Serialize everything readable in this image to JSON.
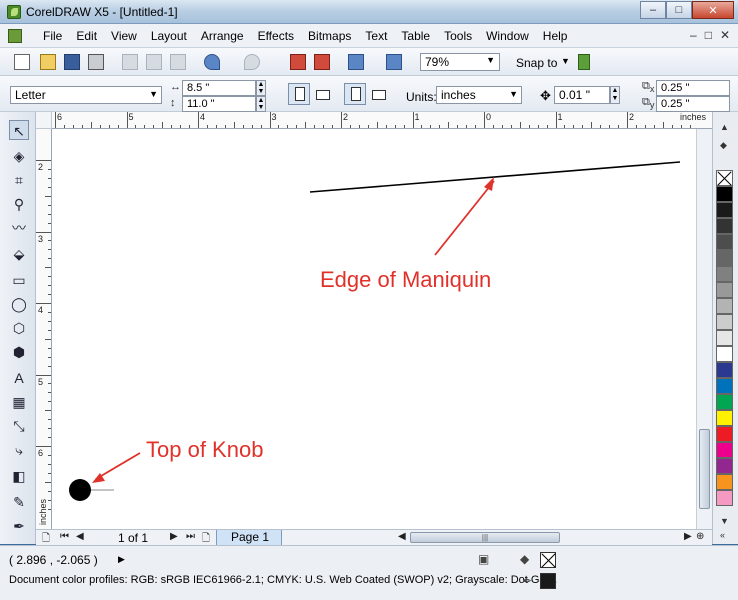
{
  "window": {
    "title": "CorelDRAW X5 - [Untitled-1]",
    "minimize_label": "–",
    "maximize_label": "□",
    "close_label": "✕"
  },
  "menu": {
    "items": [
      "File",
      "Edit",
      "View",
      "Layout",
      "Arrange",
      "Effects",
      "Bitmaps",
      "Text",
      "Table",
      "Tools",
      "Window",
      "Help"
    ],
    "doc_controls": [
      "–",
      "□",
      "✕"
    ]
  },
  "standard_toolbar": {
    "zoom_level": "79%",
    "snap_to_label": "Snap to"
  },
  "property_bar": {
    "paper_size": "Letter",
    "width": "8.5 \"",
    "height": "11.0 \"",
    "units_label": "Units:",
    "units_value": "inches",
    "nudge": "0.01 \"",
    "dup_x": "0.25 \"",
    "dup_y": "0.25 \"",
    "dup_x_label": "x",
    "dup_y_label": "y"
  },
  "rulers": {
    "horizontal_numbers": [
      "6",
      "5",
      "4",
      "3",
      "2",
      "1",
      "0",
      "1",
      "2"
    ],
    "horizontal_unit": "inches",
    "vertical_numbers": [
      "2",
      "3",
      "4",
      "5",
      "6"
    ],
    "vertical_unit": "inches"
  },
  "canvas": {
    "annotation_edge": "Edge of Maniquin",
    "annotation_knob": "Top of Knob",
    "annotation_color": "#e0322a"
  },
  "page_nav": {
    "page_info": "1 of 1",
    "page_tab": "Page 1"
  },
  "status": {
    "coordinates": "( 2.896 , -2.065 )",
    "color_profiles": "Document color profiles: RGB: sRGB IEC61966-2.1; CMYK: U.S. Web Coated (SWOP) v2; Grayscale: Dot Gai..."
  },
  "palette": {
    "colors": [
      "#000000",
      "#1a1a1a",
      "#333333",
      "#4d4d4d",
      "#666666",
      "#808080",
      "#999999",
      "#b3b3b3",
      "#cccccc",
      "#e6e6e6",
      "#ffffff",
      "#2b3990",
      "#0072bc",
      "#00a651",
      "#fff200",
      "#ed1c24",
      "#ec008c",
      "#92278f",
      "#f7941d",
      "#f49ac2"
    ]
  }
}
